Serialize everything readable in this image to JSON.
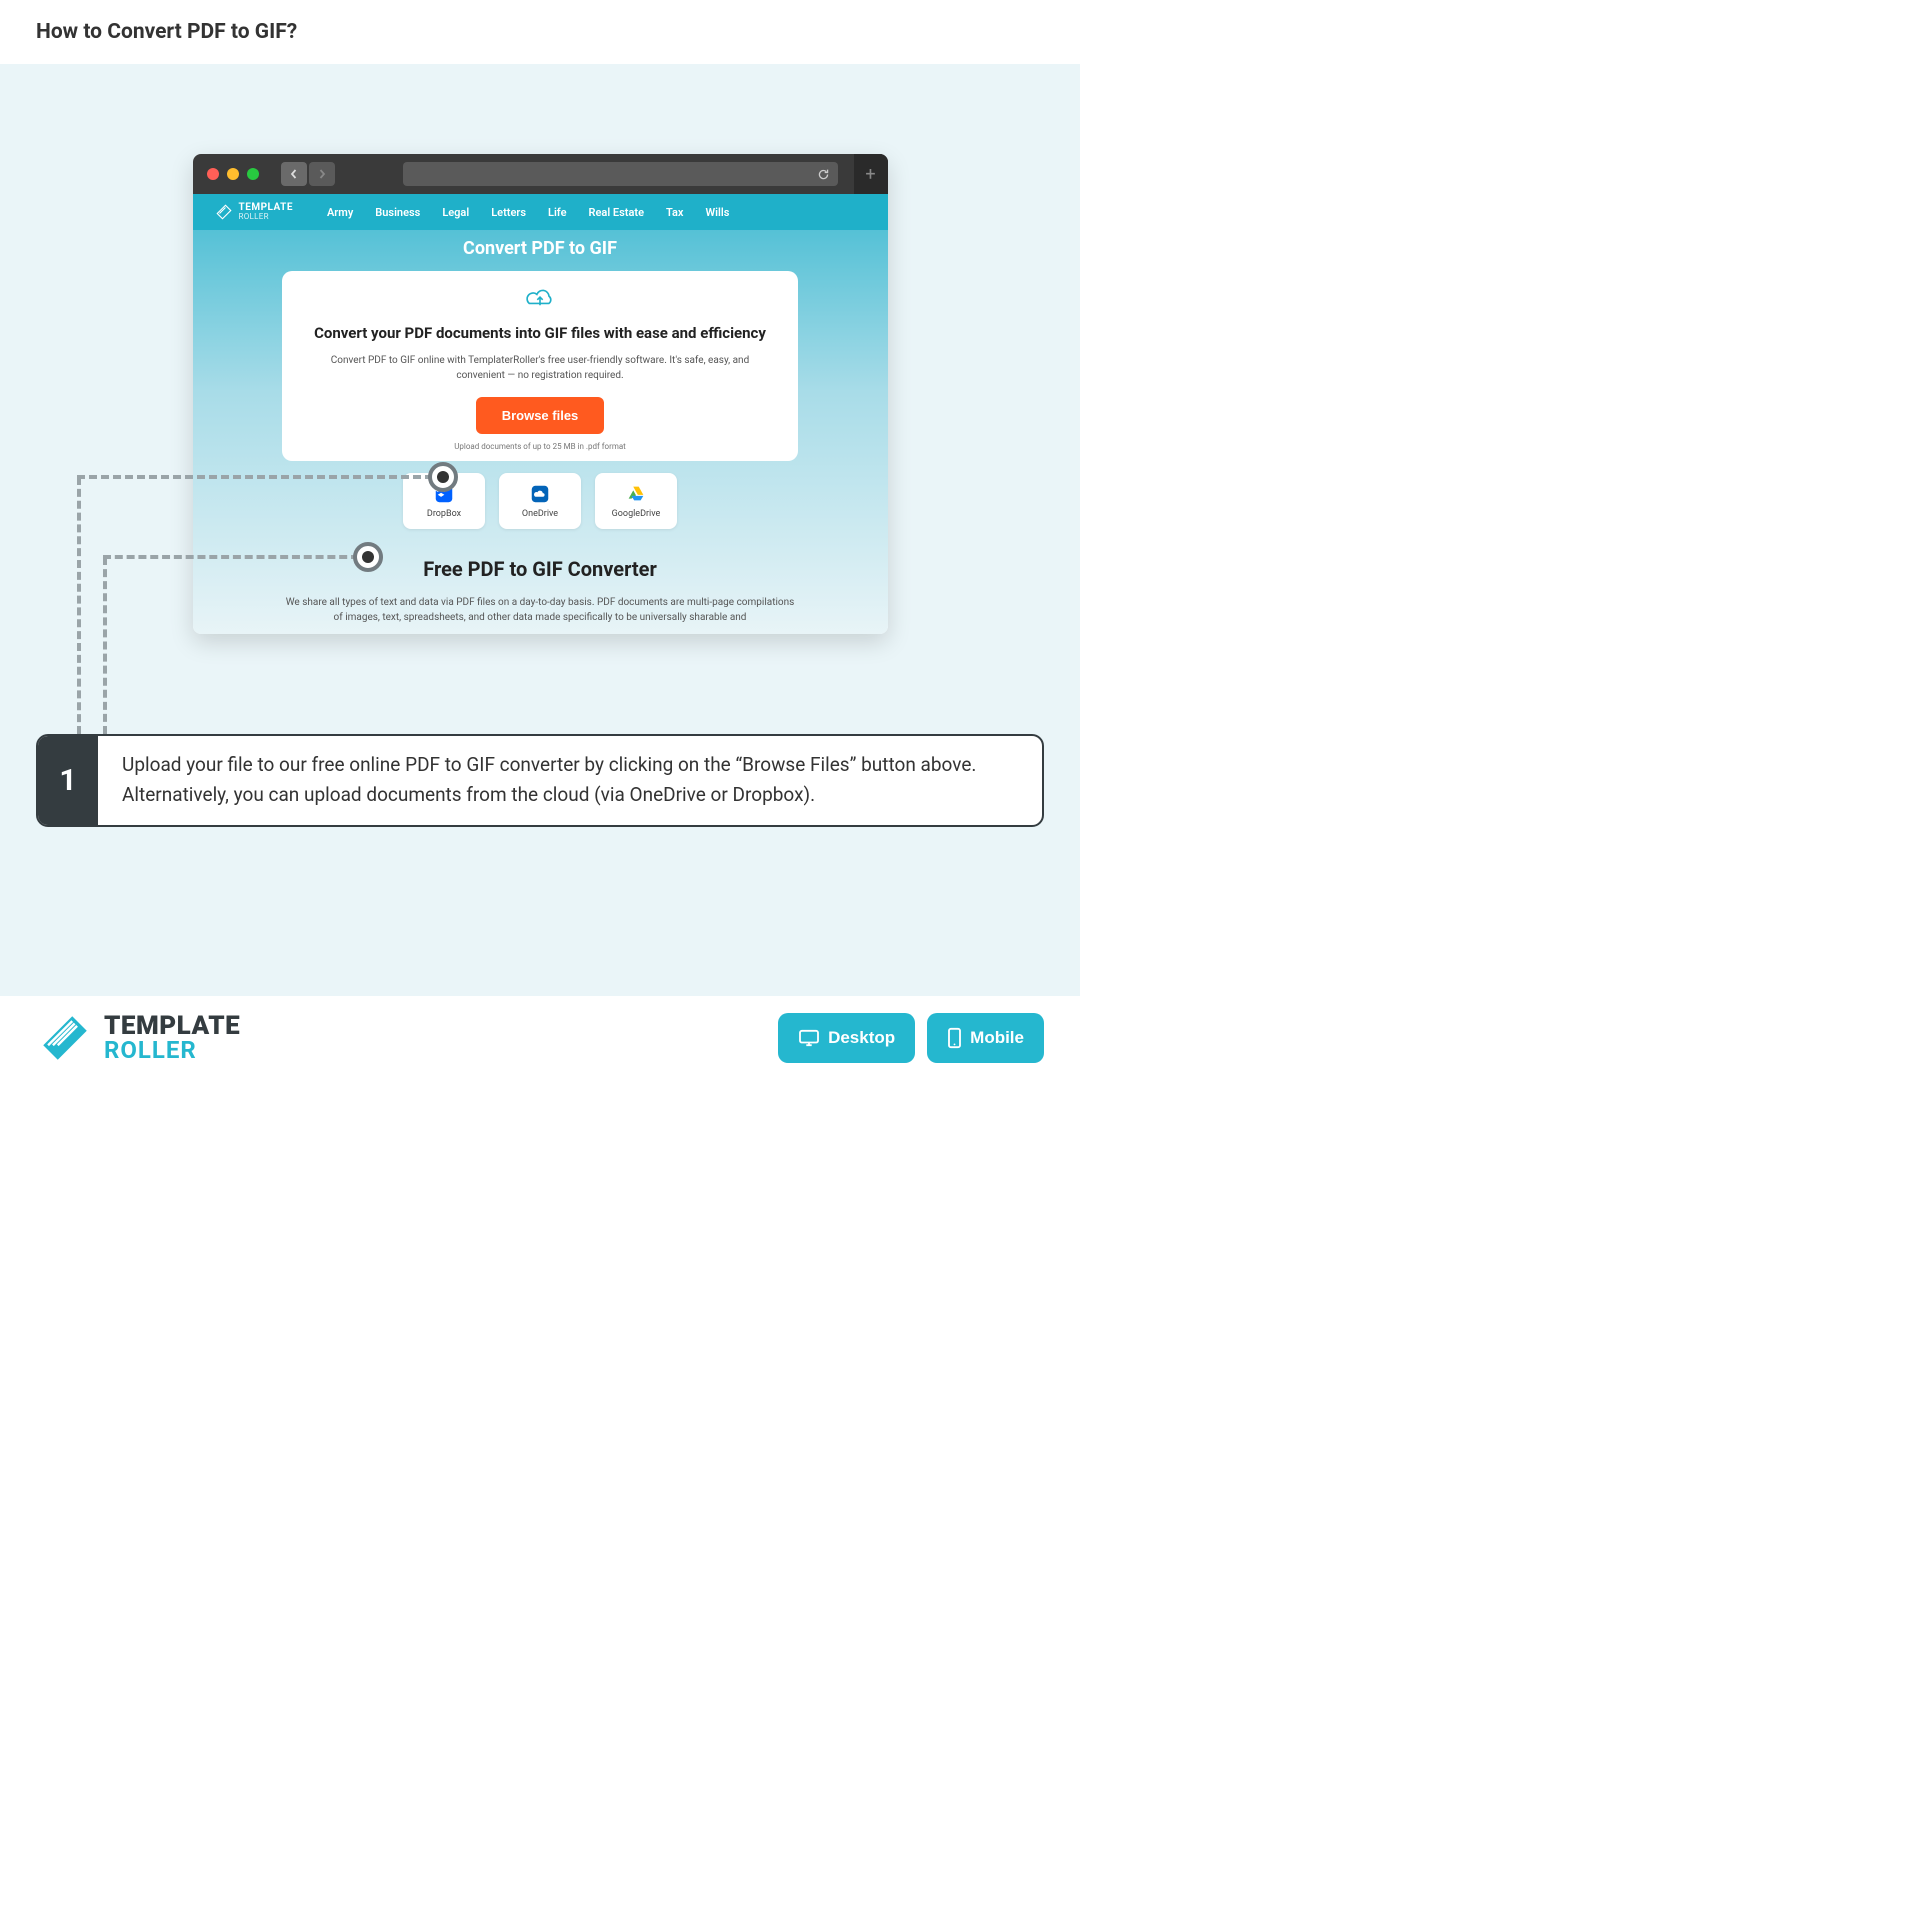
{
  "header": {
    "title": "How to Convert PDF to GIF?"
  },
  "app": {
    "logo": {
      "line1": "TEMPLATE",
      "line2": "ROLLER"
    },
    "nav": [
      "Army",
      "Business",
      "Legal",
      "Letters",
      "Life",
      "Real Estate",
      "Tax",
      "Wills"
    ]
  },
  "banner": {
    "title": "Convert PDF to GIF",
    "card_title": "Convert your PDF documents into GIF files with ease and efficiency",
    "card_desc": "Convert PDF to GIF online with TemplaterRoller's free user-friendly software. It's safe, easy, and convenient — no registration required.",
    "browse_label": "Browse files",
    "upload_note": "Upload documents of up to 25 MB in .pdf format",
    "clouds": [
      {
        "name": "DropBox"
      },
      {
        "name": "OneDrive"
      },
      {
        "name": "GoogleDrive"
      }
    ],
    "section2_title": "Free PDF to GIF Converter",
    "section2_para": "We share all types of text and data via PDF files on a day-to-day basis. PDF documents are multi-page compilations of images, text, spreadsheets, and other data made specifically to be universally sharable and"
  },
  "step": {
    "number": "1",
    "text": "Upload your file to our free online PDF to GIF converter by clicking on the “Browse Files” button above. Alternatively, you can upload documents from the cloud (via OneDrive or Dropbox)."
  },
  "footer": {
    "logo": {
      "line1": "TEMPLATE",
      "line2": "ROLLER"
    },
    "desktop": "Desktop",
    "mobile": "Mobile"
  }
}
